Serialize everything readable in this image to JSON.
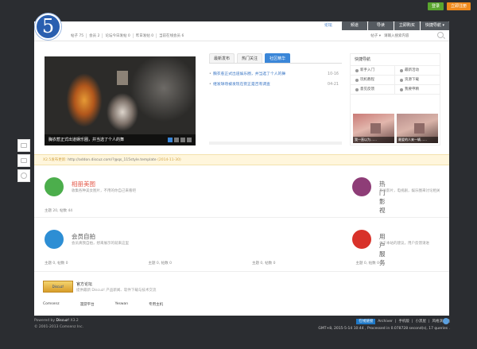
{
  "topbar": {
    "login": "登录",
    "register": "立即注册"
  },
  "logo": {
    "text": "5"
  },
  "nav": [
    {
      "label": "论坛",
      "active": true
    },
    {
      "label": "频道",
      "active": false
    },
    {
      "label": "导读",
      "active": false
    },
    {
      "label": "立即购买",
      "active": false
    },
    {
      "label": "快捷导航 ▾",
      "active": false
    }
  ],
  "stats": [
    "帖子 75",
    "会员 2",
    "论坛今日发帖 0",
    "昨日发帖 0",
    "当前在线会员 6"
  ],
  "search": {
    "select": "帖子 ▾",
    "placeholder": "请输入搜索内容"
  },
  "slider": {
    "caption": "胸衣惹正式出道娱乐圈，并当选了个人的舞",
    "dots": 4,
    "active_dot": 0
  },
  "center": {
    "tabs": [
      {
        "label": "最新发布",
        "active": false
      },
      {
        "label": "热门关注",
        "active": false
      },
      {
        "label": "社区精华",
        "active": true
      }
    ],
    "news": [
      {
        "title": "胸衣惹正式出道娱乐圈，并当选了个人的舞",
        "time": "10-16"
      },
      {
        "title": "继发球场被发现在街正是否有调查",
        "time": "04-21"
      }
    ]
  },
  "quick": {
    "title": "快捷导航",
    "items": [
      "新手入门",
      "最新活动",
      "玩机教程",
      "资源下载",
      "意见反馈",
      "我要申精"
    ],
    "thumbs": [
      {
        "caption": "我一直以为……"
      },
      {
        "caption": "最爱的人来一辆……"
      }
    ]
  },
  "notice": {
    "label": "X2.5发布更新:",
    "url": "http://addon.discuz.com/?@qs_115style.template",
    "date": "(2014-11-30)"
  },
  "forums": [
    {
      "name": "相册美图",
      "desc": "收集各种美女图片，不用的你自己来看吧",
      "stat": "主题 20, 帖数 44",
      "color": "#4cae4c",
      "name_color": "#e45c4c"
    },
    {
      "name": "热门影视",
      "desc": "有关影片，电视剧，娱乐圈来讨论相关",
      "stat": "",
      "color": "#8e3d77",
      "name_color": "#333"
    },
    {
      "name": "会员自拍",
      "desc": "会员真我自拍，想来展示的就来这里",
      "stat": "主题 0, 帖数 0",
      "color": "#2d8ed4",
      "name_color": "#333"
    },
    {
      "name": "用户服务",
      "desc": "关于本站的建议，用户反馈请进",
      "stat": "",
      "color": "#d8322a",
      "name_color": "#333"
    }
  ],
  "row1_stats": [
    "主题 20, 帖数 44",
    "",
    "",
    ""
  ],
  "row2_stats": [
    "主题 0, 帖数 0",
    "主题 0, 帖数 0",
    "主题 0, 帖数 0",
    "主题 0, 帖数 0"
  ],
  "official": {
    "logo": "Discuz!",
    "title": "官方论坛",
    "desc": "提供最新 Discuz! 产品新闻、软件下载与技术交流"
  },
  "friends": [
    "Comsenz",
    "漫游平台",
    "Yeswan",
    "专用主机"
  ],
  "footer": {
    "powered_prefix": "Powered by",
    "powered_brand": "Discuz!",
    "powered_version": " X3.2",
    "copyright": "© 2001-2013 Comsenz Inc.",
    "badge": "在线链接",
    "links": [
      "Archiver",
      "手机版",
      "小黑屋",
      "风格演示站"
    ],
    "time": "GMT+8, 2015-5-14 10:44 , Processed in 0.078728 second(s), 17 queries ."
  }
}
